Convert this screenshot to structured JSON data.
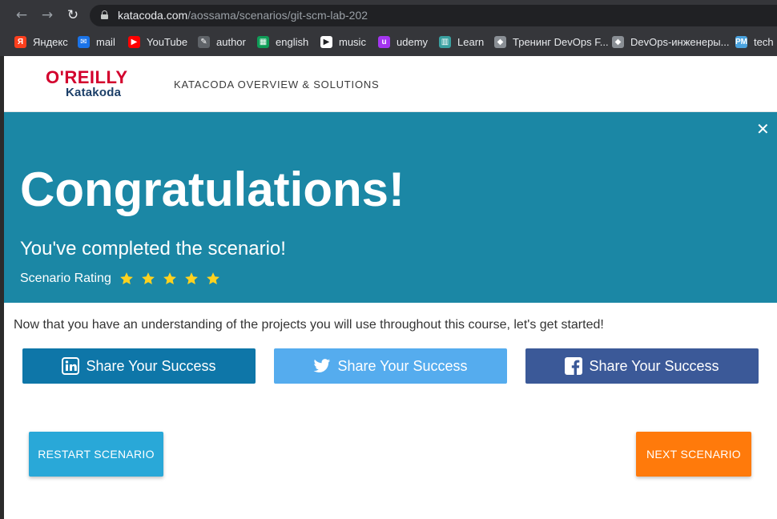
{
  "browser": {
    "url_host": "katacoda.com",
    "url_path": "/aossama/scenarios/git-scm-lab-202",
    "bookmarks": [
      {
        "label": "Яндекс",
        "icon": "yandex-icon",
        "color": "#fc3f1d",
        "glyph": "Я"
      },
      {
        "label": "mail",
        "icon": "mail-icon",
        "color": "#1a73e8",
        "glyph": "✉"
      },
      {
        "label": "YouTube",
        "icon": "youtube-icon",
        "color": "#ff0000",
        "glyph": "▶"
      },
      {
        "label": "author",
        "icon": "author-icon",
        "color": "#5f6368",
        "glyph": "✎"
      },
      {
        "label": "english",
        "icon": "sheets-icon",
        "color": "#0f9d58",
        "glyph": "▦"
      },
      {
        "label": "music",
        "icon": "play-icon",
        "color": "#ffffff",
        "glyph": "▶"
      },
      {
        "label": "udemy",
        "icon": "udemy-icon",
        "color": "#a435f0",
        "glyph": "u"
      },
      {
        "label": "Learn",
        "icon": "learn-icon",
        "color": "#3aa1a1",
        "glyph": "▥"
      },
      {
        "label": "Тренинг DevOps F...",
        "icon": "graduation-cap-icon",
        "color": "#8a8f95",
        "glyph": "◆"
      },
      {
        "label": "DevOps-инженеры...",
        "icon": "graduation-cap-icon",
        "color": "#8a8f95",
        "glyph": "◆"
      },
      {
        "label": "tech",
        "icon": "pm-icon",
        "color": "#4aa3df",
        "glyph": "PM"
      }
    ]
  },
  "header": {
    "logo_top": "O'REILLY",
    "logo_bottom": "Katakoda",
    "nav_link": "KATACODA OVERVIEW & SOLUTIONS"
  },
  "banner": {
    "title": "Congratulations!",
    "subtitle": "You've completed the scenario!",
    "rating_label": "Scenario Rating",
    "rating_stars": 5,
    "rating_max": 5,
    "background": "#1b87a5",
    "star_color": "#ffd21f"
  },
  "main": {
    "message": "Now that you have an understanding of the projects you will use throughout this course, let's get started!",
    "share_buttons": [
      {
        "label": "Share Your Success",
        "network": "linkedin",
        "color": "#0e76a8"
      },
      {
        "label": "Share Your Success",
        "network": "twitter",
        "color": "#55acee"
      },
      {
        "label": "Share Your Success",
        "network": "facebook",
        "color": "#3b5998"
      }
    ],
    "restart_label": "RESTART SCENARIO",
    "next_label": "NEXT SCENARIO"
  }
}
